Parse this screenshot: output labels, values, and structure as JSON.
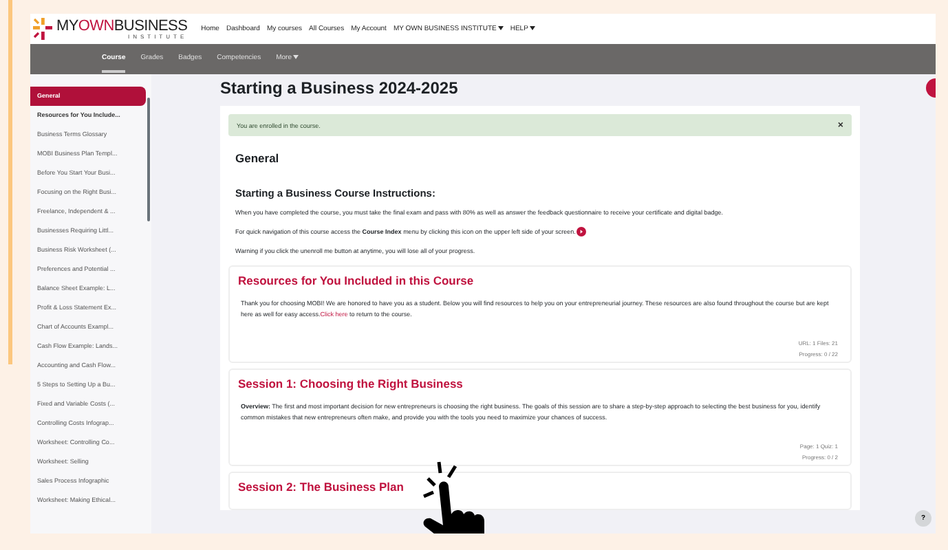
{
  "logo": {
    "parts": [
      "MY",
      "OWN",
      "BUSINESS"
    ],
    "subtitle": "INSTITUTE"
  },
  "top_nav": [
    {
      "label": "Home",
      "dropdown": false
    },
    {
      "label": "Dashboard",
      "dropdown": false
    },
    {
      "label": "My courses",
      "dropdown": false
    },
    {
      "label": "All Courses",
      "dropdown": false
    },
    {
      "label": "My Account",
      "dropdown": false
    },
    {
      "label": "MY OWN BUSINESS INSTITUTE",
      "dropdown": true
    },
    {
      "label": "HELP",
      "dropdown": true
    }
  ],
  "course_tabs": [
    {
      "label": "Course",
      "selected": true,
      "dropdown": false
    },
    {
      "label": "Grades",
      "selected": false,
      "dropdown": false
    },
    {
      "label": "Badges",
      "selected": false,
      "dropdown": false
    },
    {
      "label": "Competencies",
      "selected": false,
      "dropdown": false
    },
    {
      "label": "More",
      "selected": false,
      "dropdown": true
    }
  ],
  "sidebar": {
    "items": [
      {
        "label": "General",
        "kind": "section",
        "selected": true
      },
      {
        "label": "Resources for You Include...",
        "kind": "section",
        "selected": false
      },
      {
        "label": "Business Terms Glossary",
        "kind": "activity",
        "selected": false
      },
      {
        "label": "MOBI Business Plan Templ...",
        "kind": "activity",
        "selected": false
      },
      {
        "label": "Before You Start Your Busi...",
        "kind": "activity",
        "selected": false
      },
      {
        "label": "Focusing on the Right Busi...",
        "kind": "activity",
        "selected": false
      },
      {
        "label": "Freelance, Independent & ...",
        "kind": "activity",
        "selected": false
      },
      {
        "label": "Businesses Requiring Littl...",
        "kind": "activity",
        "selected": false
      },
      {
        "label": "Business Risk Worksheet (...",
        "kind": "activity",
        "selected": false
      },
      {
        "label": "Preferences and Potential ...",
        "kind": "activity",
        "selected": false
      },
      {
        "label": "Balance Sheet Example: L...",
        "kind": "activity",
        "selected": false
      },
      {
        "label": "Profit & Loss Statement Ex...",
        "kind": "activity",
        "selected": false
      },
      {
        "label": "Chart of Accounts Exampl...",
        "kind": "activity",
        "selected": false
      },
      {
        "label": "Cash Flow Example: Lands...",
        "kind": "activity",
        "selected": false
      },
      {
        "label": "Accounting and Cash Flow...",
        "kind": "activity",
        "selected": false
      },
      {
        "label": "5 Steps to Setting Up a Bu...",
        "kind": "activity",
        "selected": false
      },
      {
        "label": "Fixed and Variable Costs (...",
        "kind": "activity",
        "selected": false
      },
      {
        "label": "Controlling Costs Infograp...",
        "kind": "activity",
        "selected": false
      },
      {
        "label": "Worksheet: Controlling Co...",
        "kind": "activity",
        "selected": false
      },
      {
        "label": "Worksheet: Selling",
        "kind": "activity",
        "selected": false
      },
      {
        "label": "Sales Process Infographic",
        "kind": "activity",
        "selected": false
      },
      {
        "label": "Worksheet: Making Ethical...",
        "kind": "activity",
        "selected": false
      }
    ]
  },
  "page_title": "Starting a Business 2024-2025",
  "alert": {
    "text": "You are enrolled in the course.",
    "close": "×"
  },
  "general": {
    "heading": "General",
    "instructions_heading": "Starting a Business Course Instructions:",
    "paragraphs": [
      {
        "text": "When you have completed the course, you must take the final exam and pass with 80% as well as answer the feedback questionnaire  to receive your certificate and digital badge.",
        "icon": false
      },
      {
        "text": "For quick navigation of this course access the **Course Index** menu by clicking this icon on the upper left side of your screen.",
        "icon": true
      },
      {
        "text": "Warning if you click the unenroll me button at anytime, you will lose all of your progress.",
        "icon": false
      }
    ]
  },
  "sections": [
    {
      "title": "Resources for You Included in this Course",
      "text": "Thank you for choosing MOBI!  We are honored to have you as a student.  Below you will find resources to help you on your entrepreneurial journey.  These resources are also found throughout the course but are kept here as well for easy access.",
      "link": "Click here",
      "text_after": "to return to the course.",
      "meta": [
        "URL: 1   Files: 21",
        "Progress: 0 / 22"
      ]
    },
    {
      "title": "Session 1: Choosing the Right Business",
      "text": "**Overview:** The first and most important decision for new entrepreneurs is choosing the right business. The goals of this session are to share a step-by-step approach to selecting the best business for you, identify common mistakes that new entrepreneurs often make, and provide you with the tools you need to maximize your chances of success.",
      "meta": [
        "Page: 1   Quiz: 1",
        "Progress: 0 / 2"
      ]
    },
    {
      "title": "Session 2: The Business Plan"
    }
  ],
  "help_button": "?"
}
